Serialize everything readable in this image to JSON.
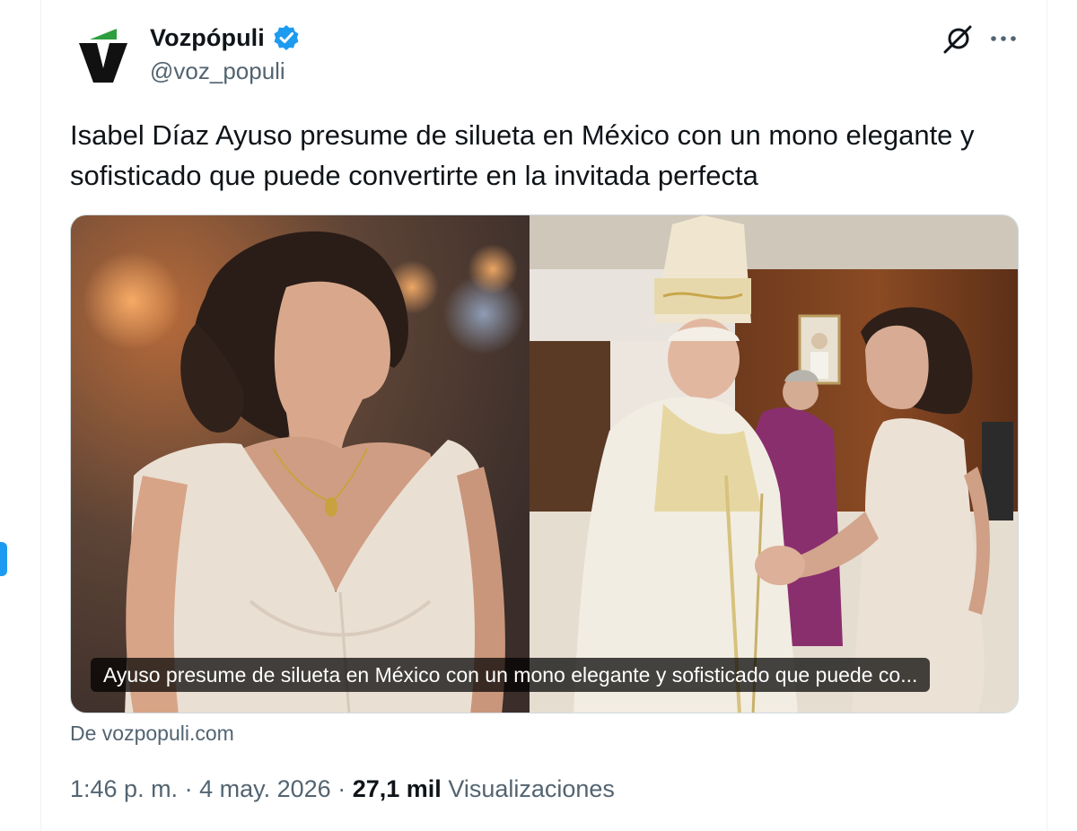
{
  "author": {
    "display_name": "Vozpópuli",
    "handle": "@voz_populi",
    "verified": true
  },
  "icons": {
    "verified": "verified-badge-icon",
    "grok": "grok-icon",
    "more": "more-options-icon",
    "avatar_logo": "vozpopuli-v-logo"
  },
  "tweet": {
    "text": "Isabel Díaz Ayuso presume de silueta en México con un mono elegante y sofisticado que puede convertirte en la invitada perfecta"
  },
  "card": {
    "caption": "Ayuso presume de silueta en México con un mono elegante y sofisticado que puede co...",
    "source": "De vozpopuli.com"
  },
  "meta": {
    "time": "1:46 p. m.",
    "separator": "·",
    "date": "4 may. 2026",
    "views_count": "27,1 mil",
    "views_label": "Visualizaciones"
  },
  "colors": {
    "accent": "#1d9bf0",
    "text_primary": "#0f1419",
    "text_secondary": "#536471",
    "logo_green": "#2e9e3e"
  }
}
